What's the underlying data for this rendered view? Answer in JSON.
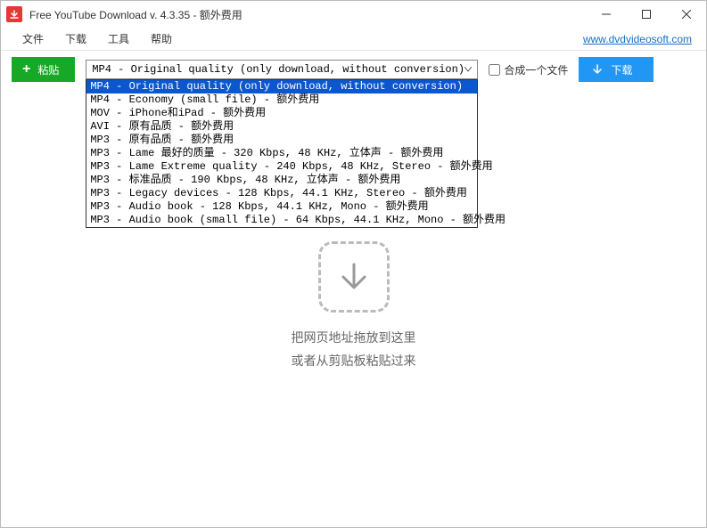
{
  "titlebar": {
    "title": "Free YouTube Download v. 4.3.35 - 额外费用"
  },
  "menubar": {
    "file": "文件",
    "download": "下载",
    "tools": "工具",
    "help": "帮助",
    "link": "www.dvdvideosoft.com"
  },
  "toolbar": {
    "paste_label": "粘贴",
    "selected_quality": "MP4 - Original quality (only download, without conversion)",
    "quality_options": [
      "MP4 - Original quality (only download, without conversion)",
      "MP4 - Economy (small file) - 额外费用",
      "MOV - iPhone和iPad - 额外费用",
      "AVI - 原有品质 - 额外费用",
      "MP3 - 原有品质 - 额外费用",
      "MP3 - Lame 最好的质量 - 320 Kbps, 48 KHz, 立体声 - 额外费用",
      "MP3 - Lame Extreme quality - 240 Kbps, 48 KHz, Stereo - 额外费用",
      "MP3 - 标准品质 - 190 Kbps, 48 KHz, 立体声 - 额外费用",
      "MP3 - Legacy devices - 128 Kbps, 44.1 KHz, Stereo - 额外费用",
      "MP3 - Audio book - 128 Kbps, 44.1 KHz, Mono - 额外费用",
      "MP3 - Audio book (small file) - 64 Kbps, 44.1 KHz, Mono - 额外费用"
    ],
    "merge_label": "合成一个文件",
    "download_label": "下载"
  },
  "main": {
    "drop_line1": "把网页地址拖放到这里",
    "drop_line2": "或者从剪贴板粘贴过来"
  }
}
